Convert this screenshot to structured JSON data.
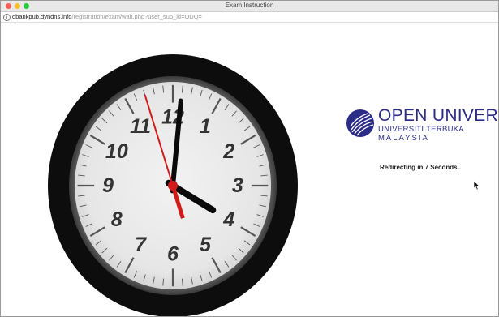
{
  "window": {
    "title": "Exam Instruction",
    "controls": [
      "close",
      "minimize",
      "zoom"
    ]
  },
  "address_bar": {
    "icon": "info-icon",
    "host": "qbankpub.dyndns.info",
    "path": "/registration/exam/wait.php?user_sub_id=ODQ="
  },
  "clock": {
    "numerals": [
      "12",
      "1",
      "2",
      "3",
      "4",
      "5",
      "6",
      "7",
      "8",
      "9",
      "10",
      "11"
    ],
    "time": {
      "hour": 4,
      "minute": 0,
      "second": 57
    }
  },
  "logo": {
    "name": "OPEN UNIVERSITY",
    "line2": "UNIVERSITI TERBUKA",
    "line3": "MALAYSIA"
  },
  "redirect": {
    "text": "Redirecting in 7 Seconds.."
  },
  "colors": {
    "brand": "#2b2c86",
    "bezel": "#0d0d0d",
    "face": "#e9e9e9",
    "second_hand": "#d11a1a",
    "hands": "#0a0a0a"
  }
}
